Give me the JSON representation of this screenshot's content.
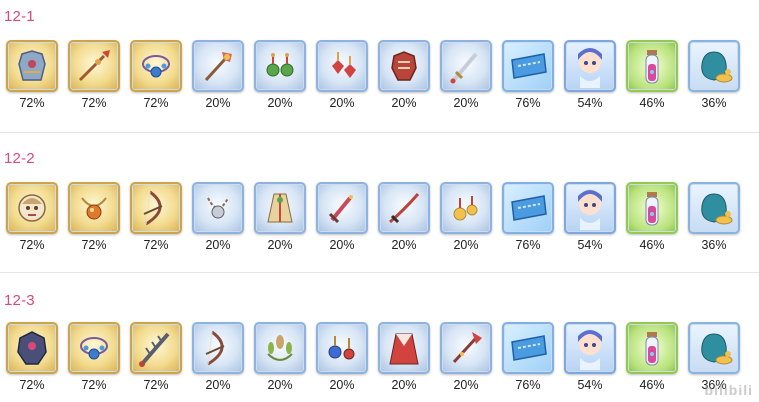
{
  "stages": [
    {
      "label": "12-1",
      "items": [
        {
          "icon": "armor-icon",
          "frame": "gold",
          "pct": "72%"
        },
        {
          "icon": "spear-icon",
          "frame": "gold",
          "pct": "72%"
        },
        {
          "icon": "blue-necklace-icon",
          "frame": "gold",
          "pct": "72%"
        },
        {
          "icon": "staff-icon",
          "frame": "silver",
          "pct": "20%"
        },
        {
          "icon": "green-earrings-icon",
          "frame": "silver",
          "pct": "20%"
        },
        {
          "icon": "red-earrings-icon",
          "frame": "silver",
          "pct": "20%"
        },
        {
          "icon": "red-armor-icon",
          "frame": "silver",
          "pct": "20%"
        },
        {
          "icon": "sword-icon",
          "frame": "silver",
          "pct": "20%"
        },
        {
          "icon": "ticket-icon",
          "frame": "ticket",
          "pct": "76%"
        },
        {
          "icon": "character-shard-icon",
          "frame": "char",
          "pct": "54%"
        },
        {
          "icon": "potion-icon",
          "frame": "potion",
          "pct": "46%"
        },
        {
          "icon": "coin-bag-icon",
          "frame": "bag",
          "pct": "36%"
        }
      ]
    },
    {
      "label": "12-2",
      "items": [
        {
          "icon": "lion-helm-icon",
          "frame": "gold",
          "pct": "72%"
        },
        {
          "icon": "orb-necklace-icon",
          "frame": "gold",
          "pct": "72%"
        },
        {
          "icon": "bow-icon",
          "frame": "gold",
          "pct": "72%"
        },
        {
          "icon": "chain-necklace-icon",
          "frame": "silver",
          "pct": "20%"
        },
        {
          "icon": "robe-icon",
          "frame": "silver",
          "pct": "20%"
        },
        {
          "icon": "dagger-icon",
          "frame": "silver",
          "pct": "20%"
        },
        {
          "icon": "katana-icon",
          "frame": "silver",
          "pct": "20%"
        },
        {
          "icon": "gold-earrings-icon",
          "frame": "silver",
          "pct": "20%"
        },
        {
          "icon": "ticket-icon",
          "frame": "ticket",
          "pct": "76%"
        },
        {
          "icon": "character-shard-icon",
          "frame": "char",
          "pct": "54%"
        },
        {
          "icon": "potion-icon",
          "frame": "potion",
          "pct": "46%"
        },
        {
          "icon": "coin-bag-icon",
          "frame": "bag",
          "pct": "36%"
        }
      ]
    },
    {
      "label": "12-3",
      "items": [
        {
          "icon": "dark-armor-icon",
          "frame": "gold",
          "pct": "72%"
        },
        {
          "icon": "blue-necklace-icon",
          "frame": "gold",
          "pct": "72%"
        },
        {
          "icon": "spiked-blade-icon",
          "frame": "gold",
          "pct": "72%"
        },
        {
          "icon": "bow-icon",
          "frame": "silver",
          "pct": "20%"
        },
        {
          "icon": "laurel-icon",
          "frame": "silver",
          "pct": "20%"
        },
        {
          "icon": "blue-earrings-icon",
          "frame": "silver",
          "pct": "20%"
        },
        {
          "icon": "red-robe-icon",
          "frame": "silver",
          "pct": "20%"
        },
        {
          "icon": "red-staff-icon",
          "frame": "silver",
          "pct": "20%"
        },
        {
          "icon": "ticket-icon",
          "frame": "ticket",
          "pct": "76%"
        },
        {
          "icon": "character-shard-icon",
          "frame": "char",
          "pct": "54%"
        },
        {
          "icon": "potion-icon",
          "frame": "potion",
          "pct": "46%"
        },
        {
          "icon": "coin-bag-icon",
          "frame": "bag",
          "pct": "36%"
        }
      ]
    }
  ],
  "watermark": "bilibili"
}
